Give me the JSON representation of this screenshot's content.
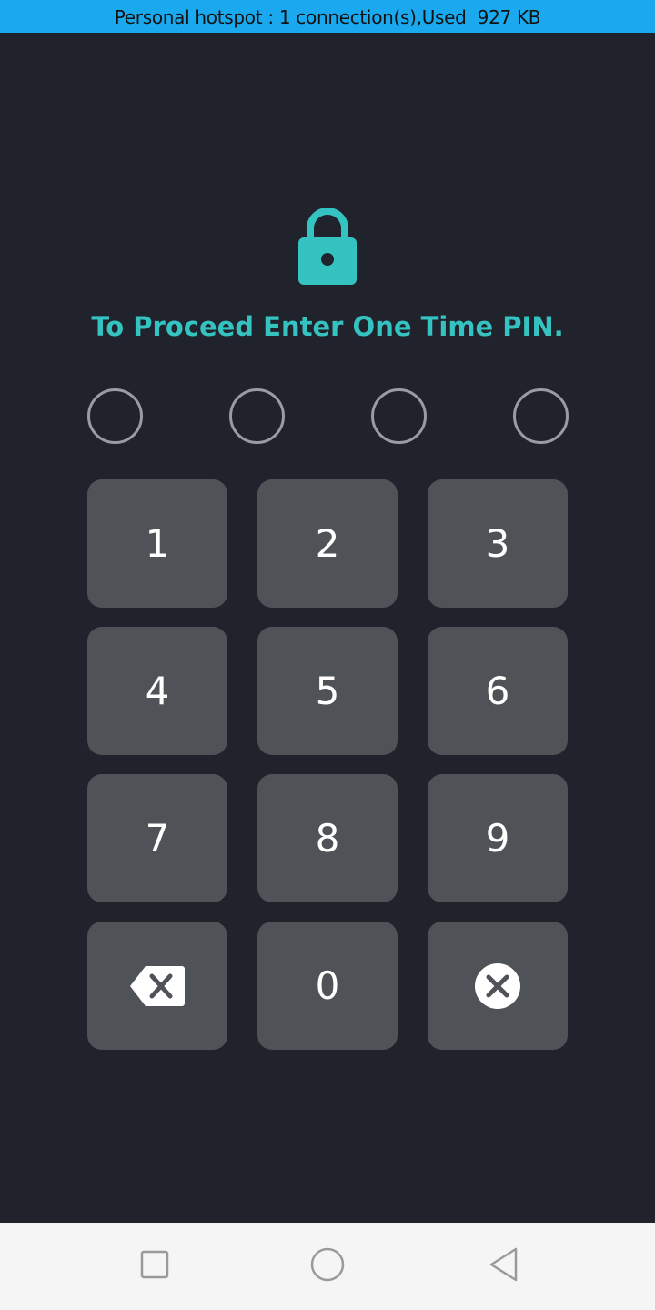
{
  "hotspot_bar": {
    "text": "Personal hotspot : 1 connection(s),Used  927 KB"
  },
  "lock": {
    "icon": "lock-icon",
    "color": "#35c3c1"
  },
  "prompt": {
    "text": "To Proceed Enter One Time PIN.",
    "color": "#35c3c1"
  },
  "pin": {
    "length": 4,
    "entered": 0
  },
  "keypad": {
    "keys": [
      "1",
      "2",
      "3",
      "4",
      "5",
      "6",
      "7",
      "8",
      "9"
    ],
    "zero": "0",
    "backspace_icon": "backspace-icon",
    "clear_icon": "clear-icon"
  },
  "nav_bar": {
    "recents_icon": "square-icon",
    "home_icon": "circle-icon",
    "back_icon": "triangle-back-icon"
  }
}
